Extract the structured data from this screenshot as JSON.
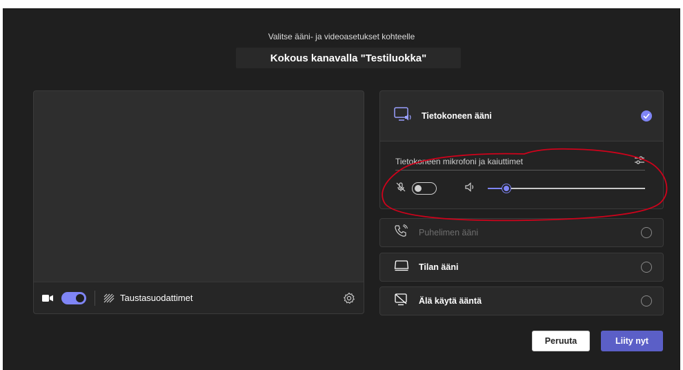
{
  "header": {
    "subtitle": "Valitse ääni- ja videoasetukset kohteelle",
    "title": "Kokous kanavalla \"Testiluokka\""
  },
  "preview": {
    "camera_on": true,
    "background_filters_label": "Taustasuodattimet"
  },
  "audio_options": {
    "computer_audio": {
      "label": "Tietokoneen ääni",
      "selected": true,
      "device_label": "Tietokoneen mikrofoni ja kaiuttimet",
      "mic_on": false,
      "volume": 0.12
    },
    "phone_audio": {
      "label": "Puhelimen ääni",
      "selected": false,
      "disabled": true
    },
    "room_audio": {
      "label": "Tilan ääni",
      "selected": false
    },
    "no_audio": {
      "label": "Älä käytä ääntä",
      "selected": false
    }
  },
  "buttons": {
    "cancel_label": "Peruuta",
    "join_label": "Liity nyt"
  },
  "colors": {
    "accent": "#7f85f5",
    "primary_button": "#5b5fc7",
    "annotation": "#d0021b",
    "background": "#1f1f1f"
  }
}
